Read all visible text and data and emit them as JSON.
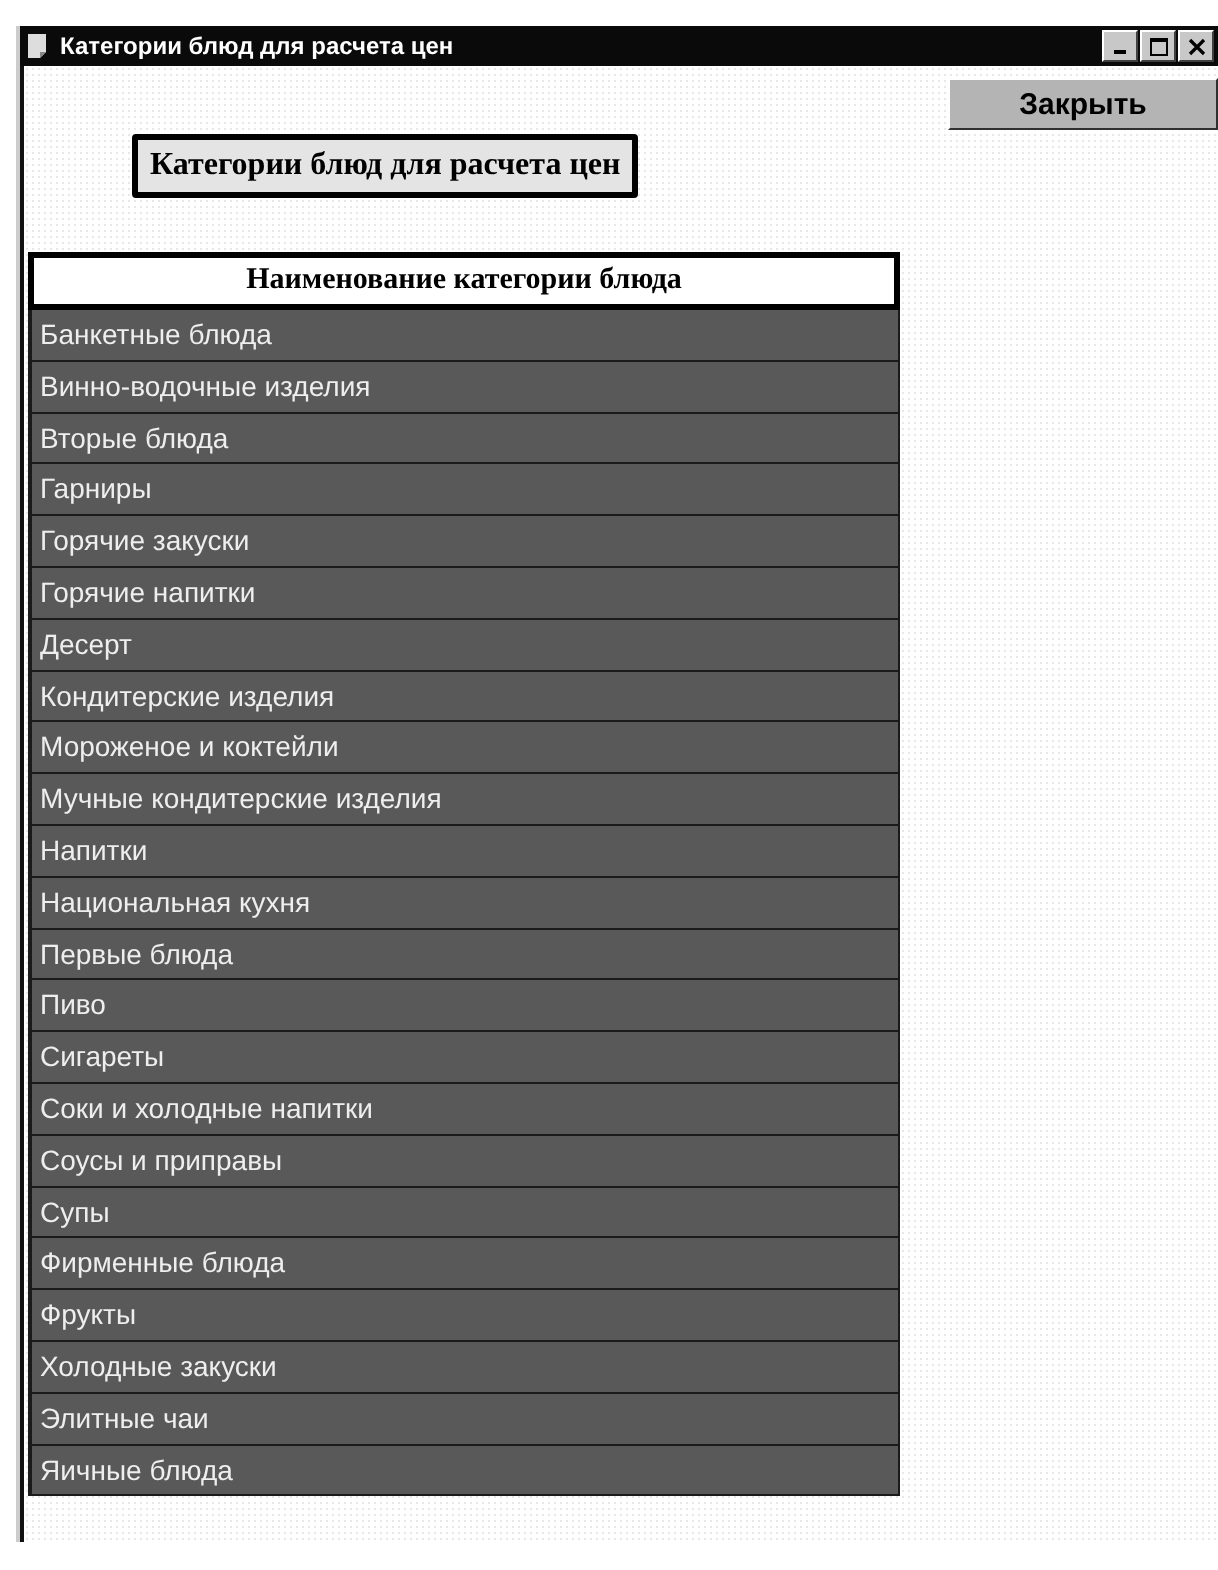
{
  "window": {
    "title": "Категории блюд для расчета цен"
  },
  "close_button": "Закрыть",
  "heading": "Категории блюд для расчета цен",
  "table": {
    "columns": [
      "Наименование категории блюда"
    ],
    "rows": [
      "Банкетные блюда",
      "Винно-водочные изделия",
      "Вторые блюда",
      "Гарниры",
      "Горячие закуски",
      "Горячие напитки",
      "Десерт",
      "Кондитерские изделия",
      "Мороженое и коктейли",
      "Мучные кондитерские изделия",
      "Напитки",
      "Национальная кухня",
      "Первые блюда",
      "Пиво",
      "Сигареты",
      "Соки и холодные напитки",
      "Соусы и приправы",
      "Супы",
      "Фирменные блюда",
      "Фрукты",
      "Холодные закуски",
      "Элитные чаи",
      "Яичные блюда"
    ]
  }
}
